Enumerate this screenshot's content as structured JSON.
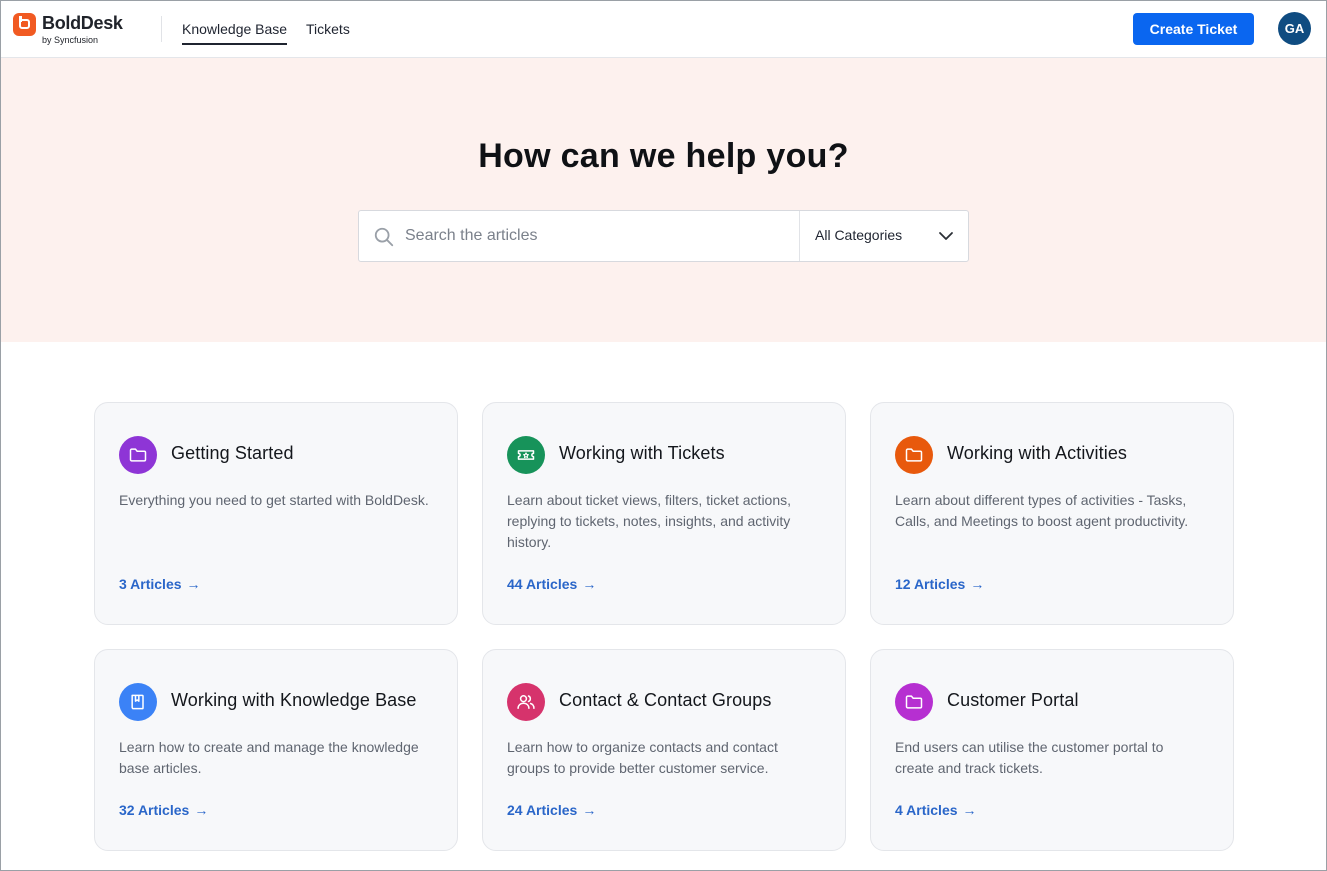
{
  "brand": {
    "name": "BoldDesk",
    "sub": "by Syncfusion",
    "logo_color": "#f15a22"
  },
  "nav": {
    "tabs": [
      {
        "label": "Knowledge Base",
        "active": true
      },
      {
        "label": "Tickets",
        "active": false
      }
    ]
  },
  "header": {
    "create_ticket_label": "Create Ticket",
    "avatar_initials": "GA",
    "accent_color": "#0a66f0"
  },
  "hero": {
    "title": "How can we help you?",
    "search_placeholder": "Search the articles",
    "search_value": "",
    "category_selected": "All Categories",
    "background": "#fdf1ee"
  },
  "categories": [
    {
      "title": "Getting Started",
      "description": "Everything you need to get started with BoldDesk.",
      "count_label": "3 Articles",
      "icon": "folder-icon",
      "color": "#8e35d6"
    },
    {
      "title": "Working with Tickets",
      "description": "Learn about ticket views, filters, ticket actions, replying to tickets, notes, insights, and activity history.",
      "count_label": "44 Articles",
      "icon": "ticket-icon",
      "color": "#17935a"
    },
    {
      "title": "Working with Activities",
      "description": "Learn about different types of activities - Tasks, Calls, and Meetings to boost agent productivity.",
      "count_label": "12 Articles",
      "icon": "folder-icon",
      "color": "#e8590c"
    },
    {
      "title": "Working with Knowledge Base",
      "description": "Learn how to create and manage the knowledge base articles.",
      "count_label": "32 Articles",
      "icon": "book-icon",
      "color": "#3b82f6"
    },
    {
      "title": "Contact & Contact Groups",
      "description": "Learn how to organize contacts and contact groups to provide better customer service.",
      "count_label": "24 Articles",
      "icon": "users-icon",
      "color": "#d6336c"
    },
    {
      "title": "Customer Portal",
      "description": "End users can utilise the customer portal to create and track tickets.",
      "count_label": "4 Articles",
      "icon": "folder-icon",
      "color": "#b62fd1"
    }
  ]
}
